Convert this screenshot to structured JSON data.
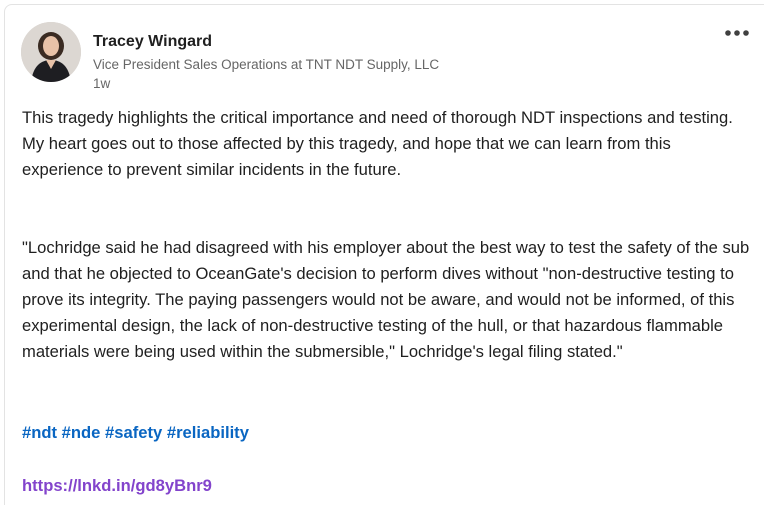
{
  "author": {
    "name": "Tracey Wingard",
    "headline": "Vice President Sales Operations at TNT NDT Supply, LLC",
    "post_age": "1w",
    "avatar_icon": "profile-photo"
  },
  "menu": {
    "more_icon": "ellipsis-icon"
  },
  "post": {
    "paragraph1": "This tragedy highlights the critical importance and need of thorough NDT inspections and testing. My heart goes out to those affected by this tragedy, and hope that we can learn from this experience to prevent similar incidents in the future.",
    "paragraph2": "\"Lochridge said he had disagreed with his employer about the best way to test the safety of the sub and that he objected to OceanGate's decision to perform dives without \"non-destructive testing to prove its integrity. The paying passengers would not be aware, and would not be informed, of this experimental design, the lack of non-destructive testing of the hull, or that hazardous flammable materials were being used within the submersible,\" Lochridge's legal filing stated.\"",
    "hashtags": [
      "#ndt",
      "#nde",
      "#safety",
      "#reliability"
    ],
    "link": "https://lnkd.in/gd8yBnr9"
  },
  "colors": {
    "hashtag": "#0a66c2",
    "visited_link": "#8344cc",
    "secondary_text": "#666666"
  }
}
